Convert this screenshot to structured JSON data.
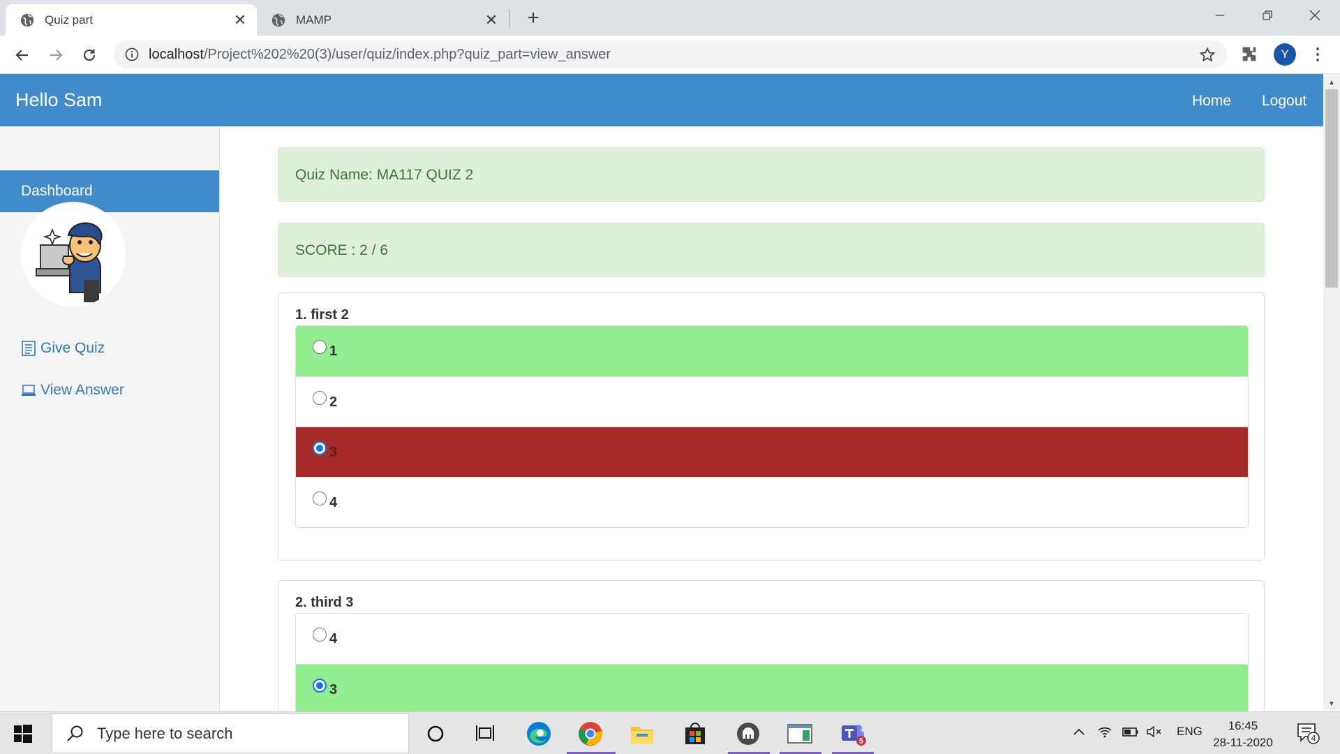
{
  "browser": {
    "tabs": [
      {
        "title": "Quiz part",
        "active": true
      },
      {
        "title": "MAMP",
        "active": false
      }
    ],
    "url_host": "localhost",
    "url_path": "/Project%202%20(3)/user/quiz/index.php?quiz_part=view_answer",
    "profile_initial": "Y"
  },
  "navbar": {
    "brand": "Hello Sam",
    "links": [
      "Home",
      "Logout"
    ]
  },
  "sidebar": {
    "dashboard": "Dashboard",
    "items": [
      "Give Quiz",
      "View Answer"
    ]
  },
  "quiz": {
    "name_text": "Quiz Name: MA117 QUIZ 2",
    "score_text": "SCORE : 2 / 6",
    "questions": [
      {
        "title": "1. first 2",
        "options": [
          {
            "label": "1",
            "selected": false,
            "status": "correct"
          },
          {
            "label": "2",
            "selected": false,
            "status": "none"
          },
          {
            "label": "3",
            "selected": true,
            "status": "wrong"
          },
          {
            "label": "4",
            "selected": false,
            "status": "none"
          }
        ]
      },
      {
        "title": "2. third 3",
        "options": [
          {
            "label": "4",
            "selected": false,
            "status": "none"
          },
          {
            "label": "3",
            "selected": true,
            "status": "correct"
          }
        ]
      }
    ]
  },
  "colors": {
    "navbar": "#428bca",
    "correct": "#90ee90",
    "wrong": "#a52a2a",
    "alert_bg": "#dff0d8",
    "alert_text": "#3c763d"
  },
  "taskbar": {
    "search_placeholder": "Type here to search",
    "language": "ENG",
    "time": "16:45",
    "date": "28-11-2020",
    "notification_count": "4",
    "teams_badge": "5"
  }
}
